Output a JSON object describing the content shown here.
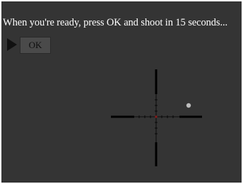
{
  "prompt": {
    "text": "When you're ready, press OK and shoot in 15 seconds..."
  },
  "controls": {
    "ok_label": "OK",
    "play_icon": "play-triangle-icon"
  },
  "scope": {
    "reticle_icon": "crosshair-reticle-icon",
    "center_dot_color": "#8b1a1a",
    "target_color": "#bdbdbd",
    "line_color": "#000000"
  }
}
